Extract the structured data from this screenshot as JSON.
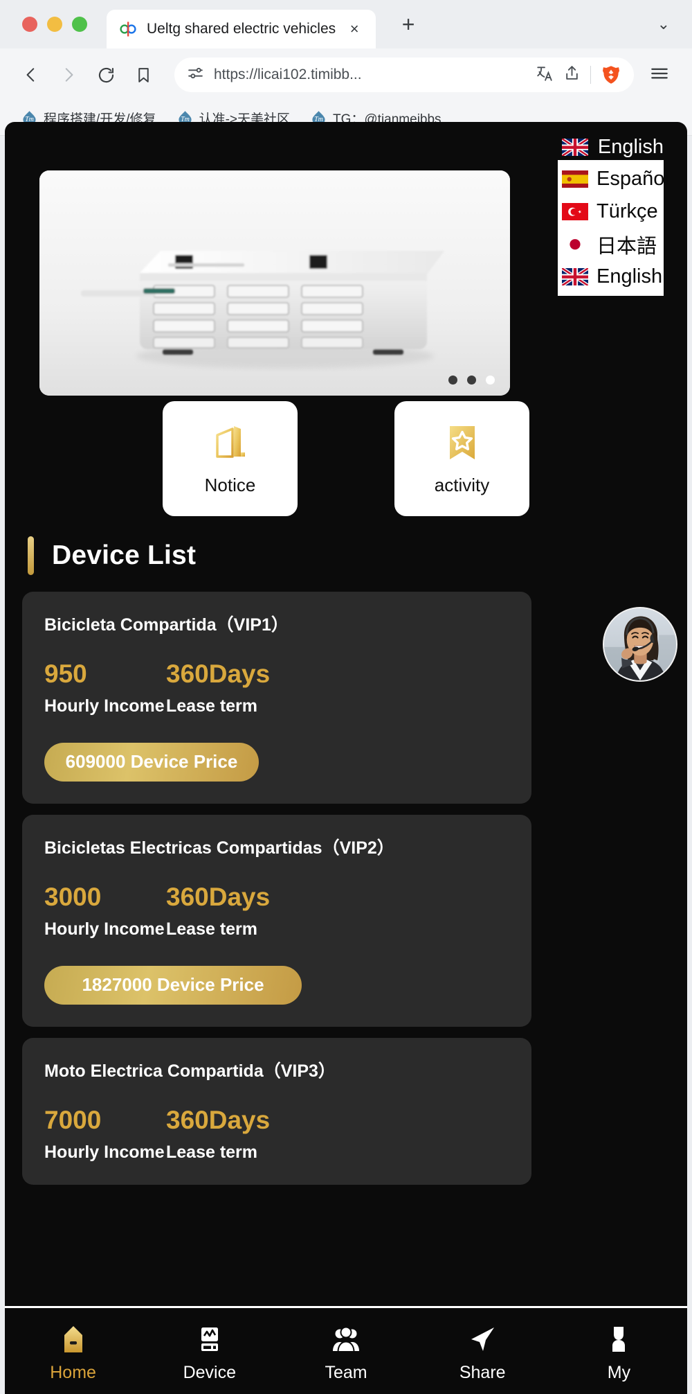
{
  "browser": {
    "tab": {
      "title": "Ueltg shared electric vehicles",
      "favicon": "link-favicon",
      "close": "×"
    },
    "new_tab": "+",
    "tab_list_chevron": "⌄",
    "nav": {
      "back": "back-arrow",
      "forward": "forward-arrow",
      "reload": "reload-arrow",
      "bookmark": "bookmark-outline"
    },
    "omnibox": {
      "permissions_icon": "site-settings-icon",
      "url": "https://licai102.timibb...",
      "translate_icon": "translate-icon",
      "share_icon": "share-icon",
      "shields_icon": "brave-shields-lion"
    },
    "menu_icon": "hamburger-menu-icon",
    "bookmarks": [
      {
        "icon": "tm-badge",
        "label": "程序搭建/开发/修复"
      },
      {
        "icon": "tm-badge",
        "label": "认准->天美社区"
      },
      {
        "icon": "tm-badge",
        "label": "TG：@tianmeibbs"
      }
    ]
  },
  "app": {
    "language_selector": {
      "flag": "uk-flag",
      "label": "English"
    },
    "language_menu": [
      {
        "flag": "es-flag",
        "label": "Español"
      },
      {
        "flag": "tr-flag",
        "label": "Türkçe"
      },
      {
        "flag": "jp-flag",
        "label": "日本語"
      },
      {
        "flag": "uk-flag",
        "label": "English"
      }
    ],
    "carousel": {
      "image_alt": "battery-swap-station",
      "dots": 3,
      "active_dot": 3
    },
    "entries": [
      {
        "icon": "building-icon",
        "label": "Notice"
      },
      {
        "icon": "bookmark-star-icon",
        "label": "activity"
      }
    ],
    "section_title": "Device List",
    "devices": [
      {
        "name": "Bicicleta Compartida（VIP1）",
        "income_value": "950",
        "income_label": "Hourly Income",
        "lease_value": "360Days",
        "lease_label": "Lease term",
        "price_label": "609000 Device Price"
      },
      {
        "name": "Bicicletas Electricas Compartidas（VIP2）",
        "income_value": "3000",
        "income_label": "Hourly Income",
        "lease_value": "360Days",
        "lease_label": "Lease term",
        "price_label": "1827000 Device Price"
      },
      {
        "name": "Moto Electrica Compartida（VIP3）",
        "income_value": "7000",
        "income_label": "Hourly Income",
        "lease_value": "360Days",
        "lease_label": "Lease term",
        "price_label": ""
      }
    ],
    "support_avatar": "customer-service-agent-photo",
    "bottom_nav": [
      {
        "icon": "home-icon",
        "label": "Home",
        "active": true
      },
      {
        "icon": "device-icon",
        "label": "Device",
        "active": false
      },
      {
        "icon": "team-icon",
        "label": "Team",
        "active": false
      },
      {
        "icon": "share-paperplane-icon",
        "label": "Share",
        "active": false
      },
      {
        "icon": "person-icon",
        "label": "My",
        "active": false
      }
    ]
  },
  "colors": {
    "gold": "#d9a83d",
    "app_bg": "#0b0b0b",
    "card_bg": "#2b2b2b"
  }
}
